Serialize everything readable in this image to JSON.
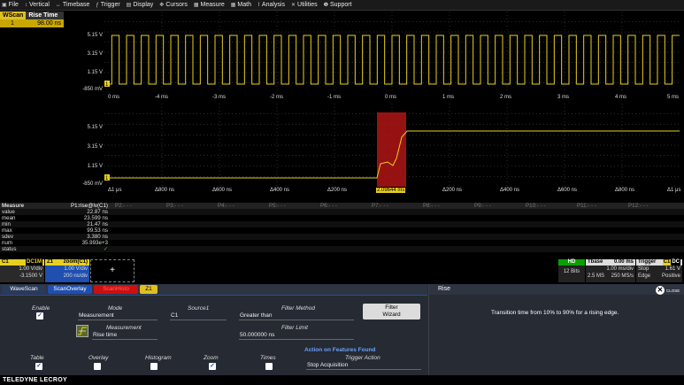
{
  "menu": {
    "items": [
      {
        "label": "File",
        "icon": "file-icon"
      },
      {
        "label": "Vertical",
        "icon": "vertical-icon"
      },
      {
        "label": "Timebase",
        "icon": "timebase-icon"
      },
      {
        "label": "Trigger",
        "icon": "trigger-icon"
      },
      {
        "label": "Display",
        "icon": "display-icon"
      },
      {
        "label": "Cursors",
        "icon": "cursors-icon"
      },
      {
        "label": "Measure",
        "icon": "measure-icon"
      },
      {
        "label": "Math",
        "icon": "math-icon"
      },
      {
        "label": "Analysis",
        "icon": "analysis-icon"
      },
      {
        "label": "Utilities",
        "icon": "utilities-icon"
      },
      {
        "label": "Support",
        "icon": "support-icon"
      }
    ]
  },
  "wavescan_table": {
    "col1": "WScan",
    "col2": "Rise Time",
    "row_index": "1",
    "row_value": "98.00 ns"
  },
  "upper_grid": {
    "y_labels": [
      "5.15 V",
      "3.15 V",
      "1.15 V",
      "-850 mV"
    ],
    "x_labels": [
      "0 ms",
      "-4 ms",
      "-3 ms",
      "-2 ms",
      "-1 ms",
      "0 ms",
      "1 ms",
      "2 ms",
      "3 ms",
      "4 ms",
      "5 ms"
    ],
    "marker": "1"
  },
  "lower_grid": {
    "y_labels": [
      "5.15 V",
      "3.15 V",
      "1.15 V",
      "-850 mV"
    ],
    "x_labels": [
      "Δ1 μs",
      "Δ800 ns",
      "Δ600 ns",
      "Δ400 ns",
      "Δ200 ns",
      "2.09644 ms",
      "Δ200 ns",
      "Δ400 ns",
      "Δ600 ns",
      "Δ800 ns",
      "Δ1 μs"
    ],
    "marker": "1"
  },
  "measure": {
    "header_label": "Measure",
    "p1_label": "P1:rise@lv(C1)",
    "params": [
      "P2:- - -",
      "P3:- - -",
      "P4:- - -",
      "P5:- - -",
      "P6:- - -",
      "P7:- - -",
      "P8:- - -",
      "P9:- - -",
      "P10:- - -",
      "P11:- - -",
      "P12:- - -"
    ],
    "rows": [
      {
        "label": "value",
        "v": "22.87 ns"
      },
      {
        "label": "mean",
        "v": "23.599 ns"
      },
      {
        "label": "min",
        "v": "21.47 ns"
      },
      {
        "label": "max",
        "v": "99.53 ns"
      },
      {
        "label": "sdev",
        "v": "3.380 ns"
      },
      {
        "label": "num",
        "v": "35.993e+3"
      },
      {
        "label": "status",
        "v": "✓"
      }
    ]
  },
  "channels": {
    "c1": {
      "name": "C1",
      "coupling": "DC1M",
      "vdiv": "1.00 V/div",
      "offset": "-3.1500 V"
    },
    "z1": {
      "name": "Z1",
      "source": "zoom(C1)",
      "vdiv": "1.00 V/div",
      "tdiv": "200 ns/div"
    },
    "add_label": "+"
  },
  "acq": {
    "hd": "HD",
    "bits": "12 Bits",
    "tbase_label": "Tbase",
    "tbase_val": "0.00 ms",
    "tdiv": "1.00 ms/div",
    "samples": "2.5 MS",
    "rate": "250 MS/s",
    "trigger_label": "Trigger",
    "trig_ch": "C1",
    "trig_cpl": "DC",
    "trig_level": "1.61 V",
    "trig_mode": "Stop",
    "trig_type": "Edge",
    "trig_slope": "Positive"
  },
  "bottom": {
    "tabs": [
      {
        "label": "WaveScan",
        "bg": "#2a3a5a",
        "fg": "#ffffff"
      },
      {
        "label": "ScanOverlay",
        "bg": "#1f4fb0",
        "fg": "#ffffff"
      },
      {
        "label": "ScanHisto",
        "bg": "#cc1010",
        "fg": "#ff6060"
      },
      {
        "label": "Z1",
        "bg": "#e0c020",
        "fg": "#000000"
      }
    ],
    "enable_label": "Enable",
    "mode_label": "Mode",
    "mode_value": "Measurement",
    "source_label": "Source1",
    "source_value": "C1",
    "filter_method_label": "Filter Method",
    "filter_method_value": "Greater than",
    "filter_wizard_label": "Filter Wizard",
    "measurement_label": "Measurement",
    "measurement_value": "Rise time",
    "filter_limit_label": "Filter Limit",
    "filter_limit_value": "50.000000 ns",
    "action_label": "Action on Features Found",
    "trigger_action_label": "Trigger Action",
    "trigger_action_value": "Stop Acquisition",
    "checks": [
      {
        "label": "Table",
        "checked": true
      },
      {
        "label": "Overlay",
        "checked": false
      },
      {
        "label": "Histogram",
        "checked": false
      },
      {
        "label": "Zoom",
        "checked": true
      },
      {
        "label": "Times",
        "checked": false
      }
    ],
    "right_title": "Rise",
    "close_label": "CLOSE",
    "description": "Transition time from 10% to 90% for a rising edge."
  },
  "footer": {
    "brand": "TELEDYNE LECROY"
  },
  "colors": {
    "trace": "#e8d020",
    "highlight": "#b01515",
    "accent": "#1f4fb0"
  }
}
